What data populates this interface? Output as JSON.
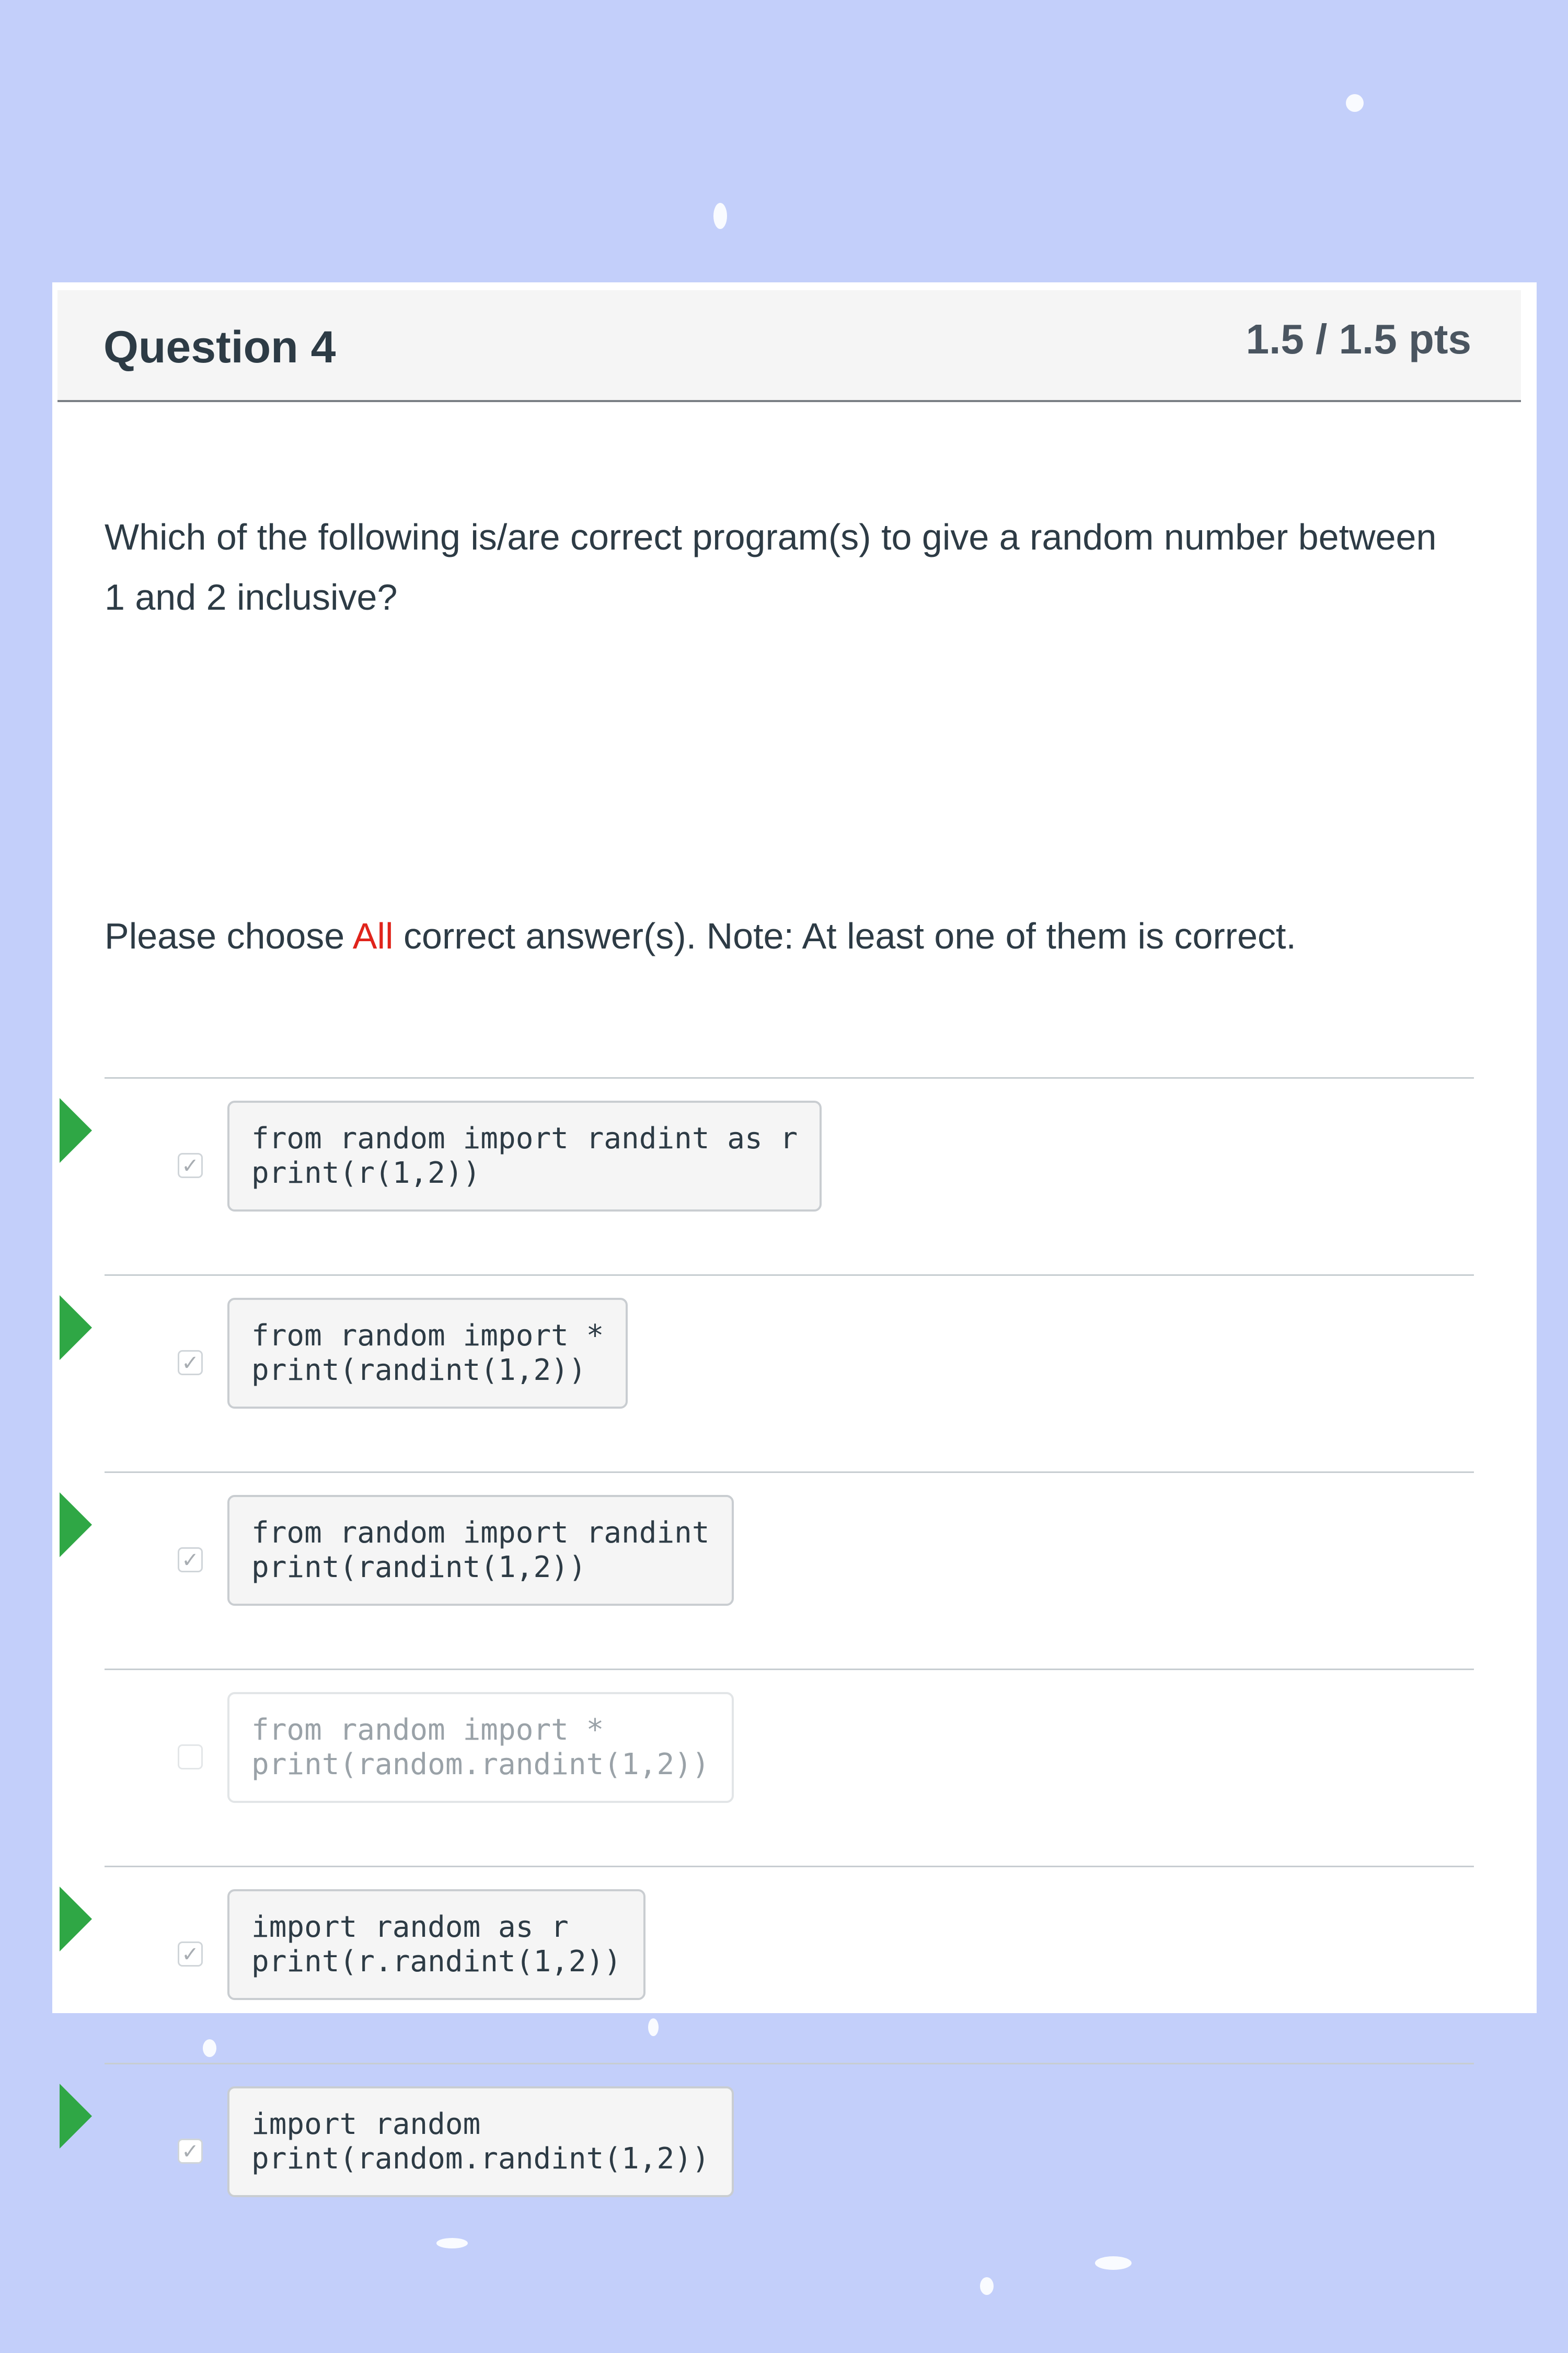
{
  "question": {
    "title": "Question 4",
    "points": "1.5 / 1.5 pts",
    "text": "Which of the following is/are correct program(s) to give a random number between 1 and 2 inclusive?",
    "instruction": {
      "prefix": "Please choose ",
      "highlight": "All",
      "suffix": " correct answer(s).  Note: At least one of them is correct."
    }
  },
  "answers": [
    {
      "line1": "from random import randint as r",
      "line2": "print(r(1,2))",
      "checked": true,
      "correct": true
    },
    {
      "line1": "from random import *",
      "line2": "print(randint(1,2))",
      "checked": true,
      "correct": true
    },
    {
      "line1": "from random import randint",
      "line2": "print(randint(1,2))",
      "checked": true,
      "correct": true
    },
    {
      "line1": "from random import *",
      "line2": "print(random.randint(1,2))",
      "checked": false,
      "correct": false
    },
    {
      "line1": "import random as r",
      "line2": "print(r.randint(1,2))",
      "checked": true,
      "correct": true
    },
    {
      "line1": "import random",
      "line2": "print(random.randint(1,2))",
      "checked": true,
      "correct": true
    }
  ],
  "icons": {
    "correct_marker": "right-arrow-icon",
    "checkbox_checked": "checkmark-icon",
    "marker_color": "#2fa745",
    "highlight_color": "#e0241b",
    "background_color": "#c3cffa"
  }
}
